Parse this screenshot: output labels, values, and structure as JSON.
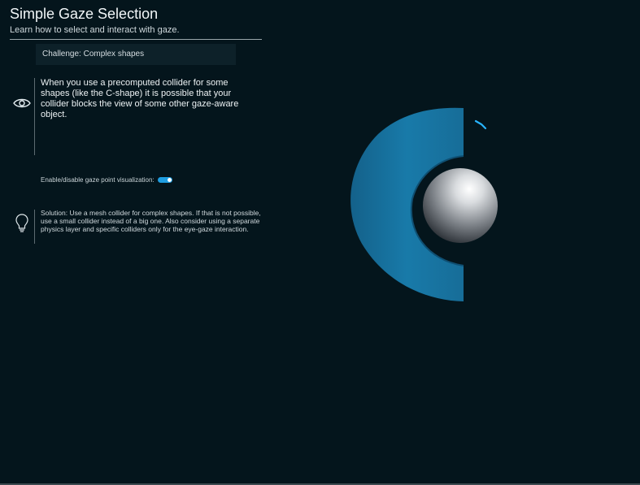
{
  "header": {
    "title": "Simple Gaze Selection",
    "subtitle": "Learn how to select and interact with gaze."
  },
  "challenge": {
    "label": "Challenge: Complex shapes"
  },
  "content": {
    "icon": "eye-icon",
    "text": "When you use a precomputed collider for some shapes (like the C-shape) it is possible that your collider blocks the view of some other gaze-aware object."
  },
  "toggle": {
    "label": "Enable/disable gaze point visualization:",
    "state": "on",
    "color": "#1f9de0"
  },
  "solution": {
    "icon": "lightbulb-icon",
    "text": "Solution: Use a mesh collider for complex shapes. If that is not possible, use a small collider instead of a big one. Also consider using a separate physics layer and specific colliders only for the eye-gaze interaction."
  },
  "scene": {
    "background": "#04151c",
    "c_shape_color": "#176d98",
    "sphere_color": "#c8cbd0",
    "gaze_marker_color": "#28b4ff"
  }
}
